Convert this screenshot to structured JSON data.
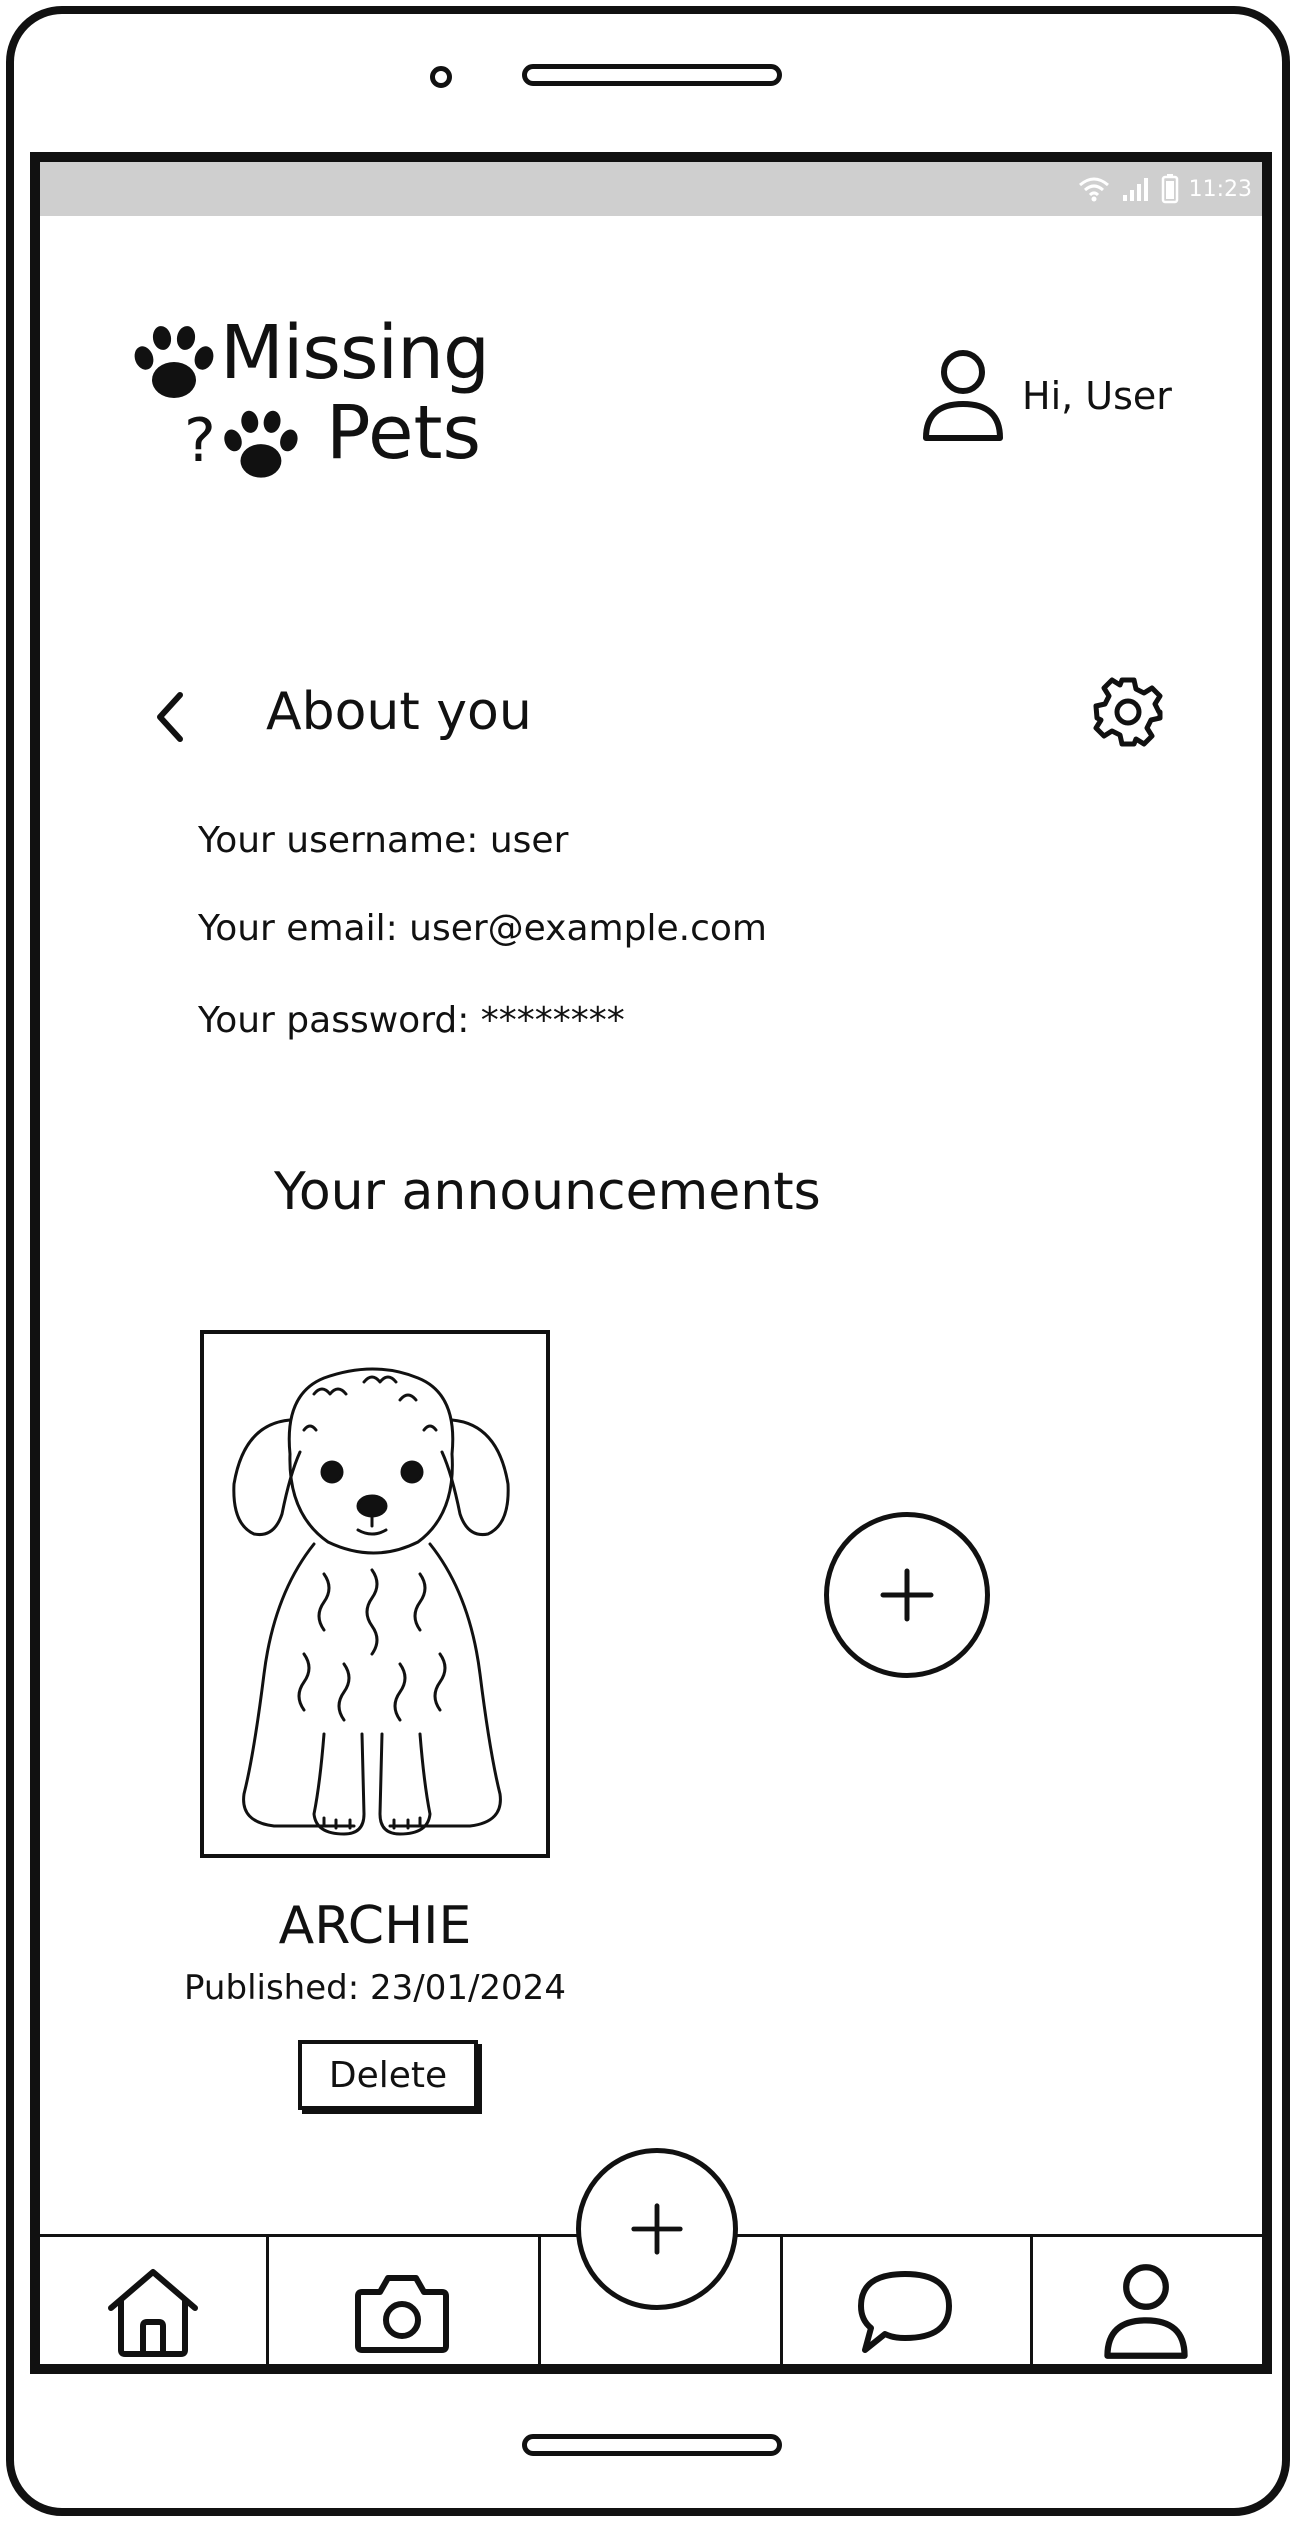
{
  "status_bar": {
    "time": "11:23"
  },
  "header": {
    "logo_line1": "Missing",
    "logo_line2": "Pets",
    "logo_question": "?",
    "user_greeting": "Hi, User"
  },
  "about": {
    "title": "About you",
    "username_line": "Your username: user",
    "email_line": "Your email: user@example.com",
    "password_line": "Your password: ********"
  },
  "announcements": {
    "title": "Your announcements",
    "items": [
      {
        "name": "ARCHIE",
        "published": "Published: 23/01/2024",
        "delete_label": "Delete"
      }
    ]
  },
  "icons": {
    "back": "chevron-left-icon",
    "settings": "gear-icon",
    "user": "user-icon",
    "add": "plus-icon",
    "home": "home-icon",
    "camera": "camera-icon",
    "chat": "chat-bubble-icon",
    "profile": "profile-icon"
  },
  "colors": {
    "ink": "#111111",
    "status_bar": "#cfcfcf",
    "background": "#ffffff"
  }
}
